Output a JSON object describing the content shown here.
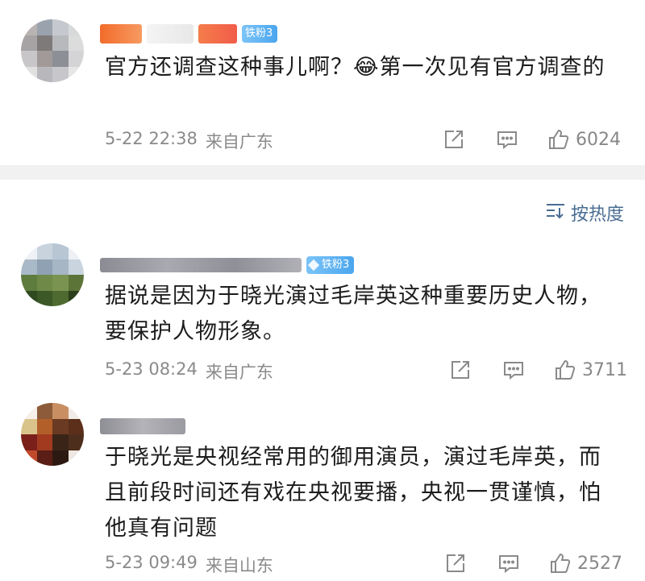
{
  "sort": {
    "label": "按热度"
  },
  "comments": [
    {
      "badge": "",
      "text": "官方还调查这种事儿啊？😂第一次见有官方调查的",
      "time": "5-22 22:38",
      "location": "来自广东",
      "likes": "6024"
    },
    {
      "badge": "铁粉3",
      "text": "据说是因为于晓光演过毛岸英这种重要历史人物，要保护人物形象。",
      "time": "5-23 08:24",
      "location": "来自广东",
      "likes": "3711"
    },
    {
      "badge": "",
      "text": "于晓光是央视经常用的御用演员，演过毛岸英，而且前段时间还有戏在央视要播，央视一贯谨慎，怕他真有问题",
      "time": "5-23 09:49",
      "location": "来自山东",
      "likes": "2527"
    }
  ],
  "first_badge": "铁粉3",
  "icons": [
    "share-icon",
    "comment-icon",
    "thumbs-up-icon",
    "sort-icon",
    "diamond-icon"
  ]
}
